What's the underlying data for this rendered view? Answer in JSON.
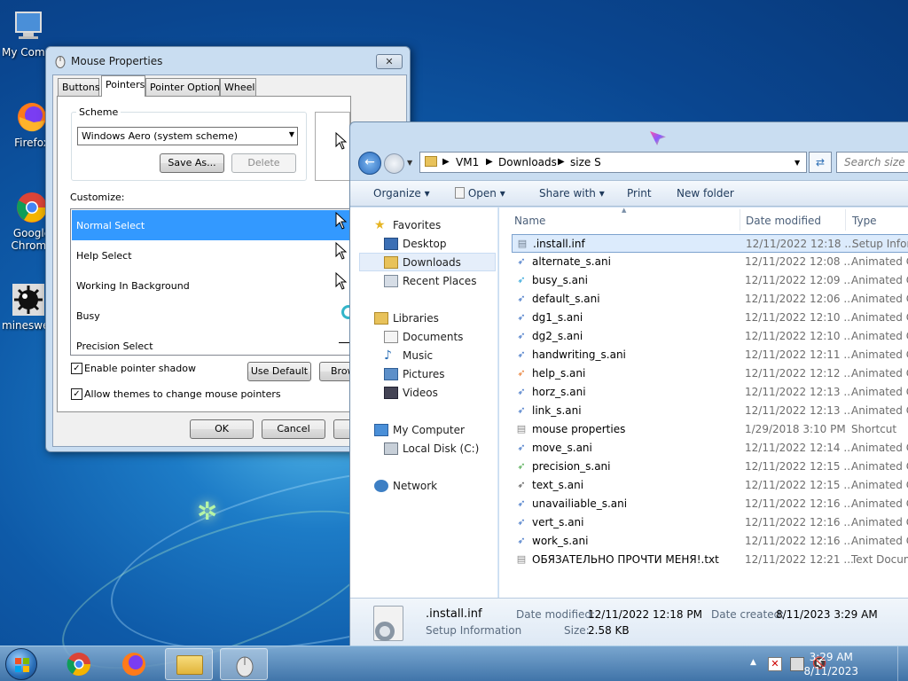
{
  "desktop": {
    "icons": [
      {
        "label": "My Computer"
      },
      {
        "label": "Firefox"
      },
      {
        "label": "Google Chrome"
      },
      {
        "label": "minesweeper"
      }
    ]
  },
  "mouse_dialog": {
    "title": "Mouse Properties",
    "tabs": [
      "Buttons",
      "Pointers",
      "Pointer Options",
      "Wheel"
    ],
    "active_tab": "Pointers",
    "scheme_label": "Scheme",
    "scheme_value": "Windows Aero (system scheme)",
    "save_as": "Save As...",
    "delete": "Delete",
    "customize_label": "Customize:",
    "pointers": [
      "Normal Select",
      "Help Select",
      "Working In Background",
      "Busy",
      "Precision Select"
    ],
    "selected_pointer": "Normal Select",
    "enable_shadow": "Enable pointer shadow",
    "allow_themes": "Allow themes to change mouse pointers",
    "use_default": "Use Default",
    "browse": "Browse...",
    "ok": "OK",
    "cancel": "Cancel"
  },
  "explorer": {
    "breadcrumb": [
      "VM1",
      "Downloads",
      "size S"
    ],
    "search_placeholder": "Search size S",
    "toolbar": {
      "organize": "Organize",
      "open": "Open",
      "share": "Share with",
      "print": "Print",
      "new_folder": "New folder"
    },
    "nav": {
      "favorites": "Favorites",
      "desktop": "Desktop",
      "downloads": "Downloads",
      "recent": "Recent Places",
      "libraries": "Libraries",
      "documents": "Documents",
      "music": "Music",
      "pictures": "Pictures",
      "videos": "Videos",
      "computer": "My Computer",
      "local_disk": "Local Disk (C:)",
      "network": "Network"
    },
    "columns": {
      "name": "Name",
      "date": "Date modified",
      "type": "Type"
    },
    "files": [
      {
        "name": ".install.inf",
        "date": "12/11/2022 12:18 ...",
        "type": "Setup Information"
      },
      {
        "name": "alternate_s.ani",
        "date": "12/11/2022 12:08 ...",
        "type": "Animated Cursor"
      },
      {
        "name": "busy_s.ani",
        "date": "12/11/2022 12:09 ...",
        "type": "Animated Cursor"
      },
      {
        "name": "default_s.ani",
        "date": "12/11/2022 12:06 ...",
        "type": "Animated Cursor"
      },
      {
        "name": "dg1_s.ani",
        "date": "12/11/2022 12:10 ...",
        "type": "Animated Cursor"
      },
      {
        "name": "dg2_s.ani",
        "date": "12/11/2022 12:10 ...",
        "type": "Animated Cursor"
      },
      {
        "name": "handwriting_s.ani",
        "date": "12/11/2022 12:11 ...",
        "type": "Animated Cursor"
      },
      {
        "name": "help_s.ani",
        "date": "12/11/2022 12:12 ...",
        "type": "Animated Cursor"
      },
      {
        "name": "horz_s.ani",
        "date": "12/11/2022 12:13 ...",
        "type": "Animated Cursor"
      },
      {
        "name": "link_s.ani",
        "date": "12/11/2022 12:13 ...",
        "type": "Animated Cursor"
      },
      {
        "name": "mouse properties",
        "date": "1/29/2018 3:10 PM",
        "type": "Shortcut"
      },
      {
        "name": "move_s.ani",
        "date": "12/11/2022 12:14 ...",
        "type": "Animated Cursor"
      },
      {
        "name": "precision_s.ani",
        "date": "12/11/2022 12:15 ...",
        "type": "Animated Cursor"
      },
      {
        "name": "text_s.ani",
        "date": "12/11/2022 12:15 ...",
        "type": "Animated Cursor"
      },
      {
        "name": "unavailiable_s.ani",
        "date": "12/11/2022 12:16 ...",
        "type": "Animated Cursor"
      },
      {
        "name": "vert_s.ani",
        "date": "12/11/2022 12:16 ...",
        "type": "Animated Cursor"
      },
      {
        "name": "work_s.ani",
        "date": "12/11/2022 12:16 ...",
        "type": "Animated Cursor"
      },
      {
        "name": "ОБЯЗАТЕЛЬНО ПРОЧТИ МЕНЯ!.txt",
        "date": "12/11/2022 12:21 ...",
        "type": "Text Document"
      }
    ],
    "details": {
      "name": ".install.inf",
      "type": "Setup Information",
      "date_modified_label": "Date modified:",
      "date_modified": "12/11/2022 12:18 PM",
      "date_created_label": "Date created:",
      "date_created": "8/11/2023 3:29 AM",
      "size_label": "Size:",
      "size": "2.58 KB"
    }
  },
  "taskbar": {
    "time": "3:29 AM",
    "date": "8/11/2023"
  },
  "colors": {
    "selection": "#3399ff",
    "accent": "#1e395b"
  }
}
